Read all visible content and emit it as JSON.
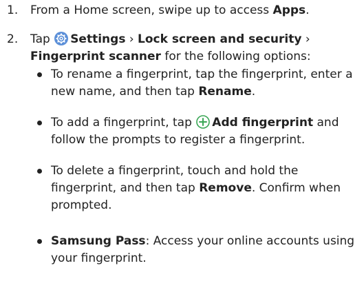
{
  "steps": [
    {
      "number": "1.",
      "t1": "From a Home screen, swipe up to access ",
      "t1_bold": "Apps",
      "t1_end": "."
    },
    {
      "number": "2.",
      "t_tap": "Tap",
      "settings": "Settings",
      "sep1": " › ",
      "lock": "Lock screen and security",
      "sep2": " ›",
      "scanner": "Fingerprint scanner",
      "rest": " for the following options:"
    }
  ],
  "bullets": [
    {
      "pre": "To rename a fingerprint, tap the fingerprint, enter a new name, and then tap ",
      "bold": "Rename",
      "post": "."
    },
    {
      "pre": "To add a fingerprint, tap",
      "bold": "Add fingerprint",
      "post": " and follow the prompts to register a fingerprint."
    },
    {
      "pre": "To delete a fingerprint, touch and hold the fingerprint, and then tap ",
      "bold": "Remove",
      "post": ". Confirm when prompted."
    },
    {
      "bold": "Samsung Pass",
      "post": ": Access your online accounts using your fingerprint."
    }
  ],
  "icons": {
    "settings": "settings-gear-icon",
    "add": "add-plus-icon"
  },
  "colors": {
    "text": "#222222",
    "settings_icon": "#5b8fd8",
    "add_icon": "#3aa655"
  }
}
